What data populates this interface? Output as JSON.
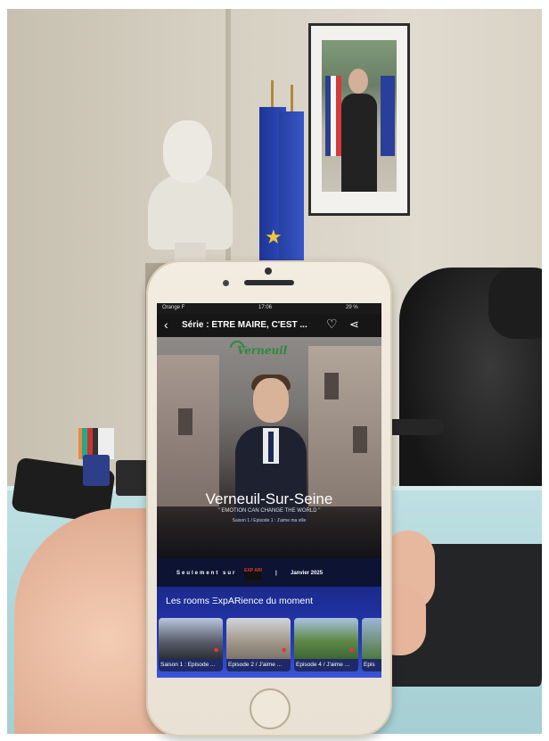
{
  "app": {
    "status": {
      "carrier": "Orange F",
      "time": "17:06",
      "battery": "29 %"
    },
    "header": {
      "back_icon": "chevron-left-icon",
      "title": "Série : ÊTRE MAIRE, C'EST ...",
      "heart_icon": "heart-icon",
      "share_icon": "share-icon"
    },
    "hero": {
      "logo": "Verneuil",
      "city": "Verneuil-Sur-Seine",
      "tagline": "\" EMOTION CAN CHANGE THE WORLD \"",
      "episode": "Saison 1 / Episode 1 : J'aime ma ville"
    },
    "release": {
      "only_on": "Seulement sur",
      "brand": "EXP ARI",
      "separator": "|",
      "date": "Janvier 2025"
    },
    "rooms": {
      "title": "Les rooms ΞxpARience du moment",
      "cards": [
        {
          "label": "Saison 1 : Episode ...",
          "pin_icon": "map-pin-icon"
        },
        {
          "label": "Episode 2 / J'aime ...",
          "pin_icon": "map-pin-icon"
        },
        {
          "label": "Episode 4 / J'aime ...",
          "pin_icon": "map-pin-icon"
        },
        {
          "label": "Epis"
        }
      ]
    },
    "colors": {
      "section_blue": "#2438b8",
      "pin_red": "#e2363c",
      "logo_green": "#2c8a3b"
    }
  }
}
